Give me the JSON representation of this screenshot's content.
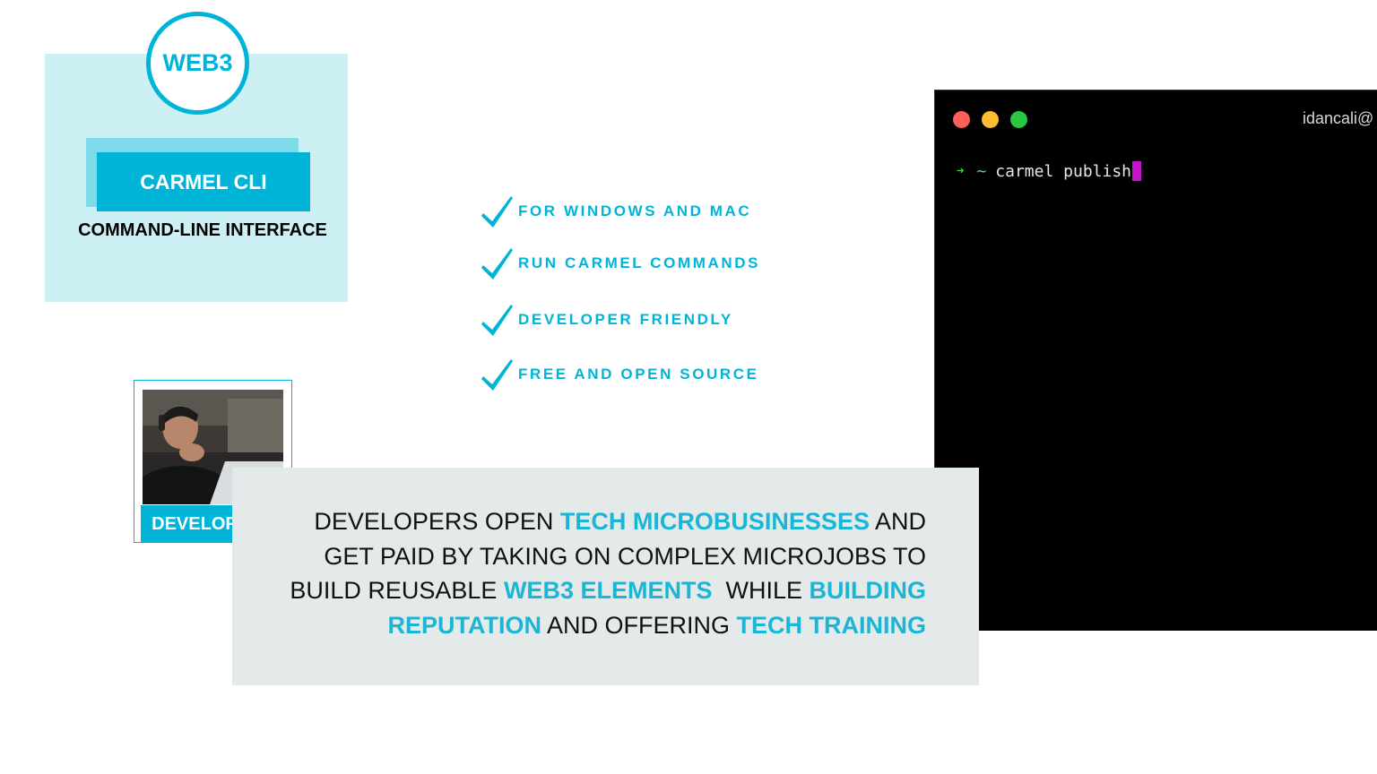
{
  "card": {
    "badge": "WEB3",
    "title": "CARMEL CLI",
    "subtitle": "COMMAND-LINE INTERFACE"
  },
  "features": [
    "FOR WINDOWS AND MAC",
    "RUN CARMEL COMMANDS",
    "DEVELOPER FRIENDLY",
    "FREE AND OPEN SOURCE"
  ],
  "terminal": {
    "title": "idancali@",
    "prompt_arrow": "➜",
    "prompt_dir": "~",
    "command": "carmel publish"
  },
  "developer": {
    "label": "DEVELOPERS"
  },
  "description": {
    "p1": "DEVELOPERS OPEN ",
    "h1": "TECH MICROBUSINESSES",
    "p2": " AND GET PAID BY TAKING ON COMPLEX MICROJOBS TO BUILD REUSABLE ",
    "h2": "WEB3 ELEMENTS",
    "p3": "  WHILE ",
    "h3": "BUILDING REPUTATION",
    "p4": " AND OFFERING ",
    "h4": "TECH TRAINING"
  },
  "colors": {
    "accent": "#00b4d8",
    "card_bg": "#cdf0f4",
    "desc_bg": "#e4e9e9",
    "cursor": "#c415c9"
  }
}
